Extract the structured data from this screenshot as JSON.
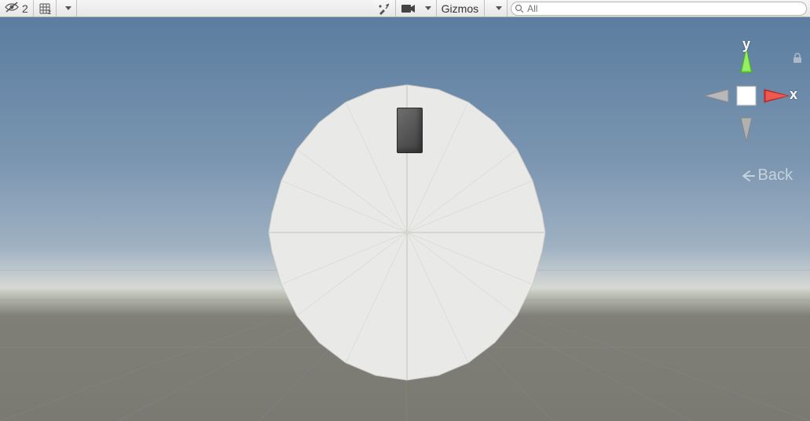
{
  "toolbar": {
    "hidden_count": "2",
    "gizmos_label": "Gizmos"
  },
  "search": {
    "placeholder": "All",
    "value": ""
  },
  "gizmo": {
    "y_label": "y",
    "x_label": "x",
    "back_label": "Back"
  }
}
